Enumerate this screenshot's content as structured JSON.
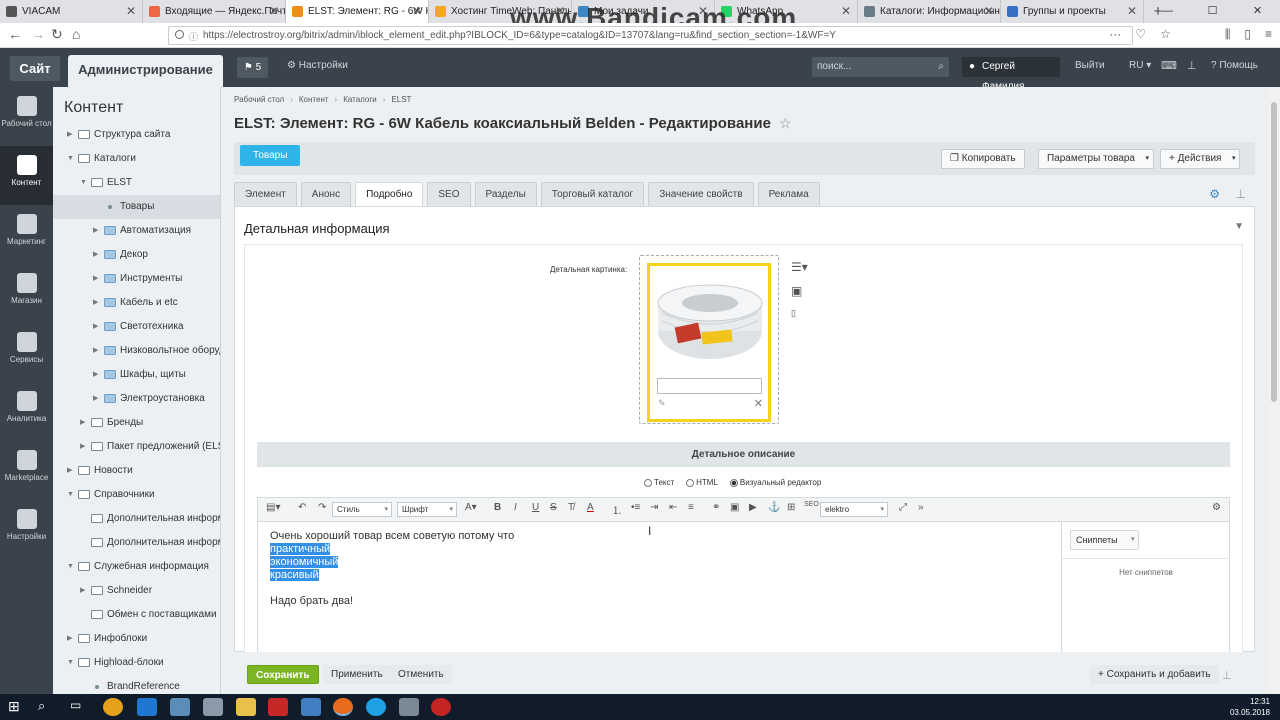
{
  "browser": {
    "tabs": [
      {
        "title": "VIACAM",
        "color": "#555"
      },
      {
        "title": "Входящие — Яндекс.Почта",
        "color": "#e64"
      },
      {
        "title": "ELST: Элемент: RG - 6W Кабе",
        "color": "#f28c1e",
        "active": true
      },
      {
        "title": "Хостинг TimeWeb: Панель",
        "color": "#f5a623"
      },
      {
        "title": "Мои задачи",
        "color": "#3b86c4"
      },
      {
        "title": "WhatsApp",
        "color": "#25d366"
      },
      {
        "title": "Каталоги: Информационн",
        "color": "#6a7b88"
      },
      {
        "title": "Группы и проекты",
        "color": "#3b6fc4"
      }
    ],
    "new_tab": "+",
    "watermark": "www.Bandicam.com",
    "url": "https://electrostroy.org/bitrix/admin/iblock_element_edit.php?IBLOCK_ID=6&type=catalog&ID=13707&lang=ru&find_section_section=-1&WF=Y"
  },
  "topbar": {
    "site": "Сайт",
    "admin": "Администрирование",
    "notifications": "5",
    "settings": "Настройки",
    "search_placeholder": "поиск...",
    "user": "Сергей Фамилия",
    "logout": "Выйти",
    "lang": "RU",
    "help": "Помощь"
  },
  "rail": [
    {
      "label": "Рабочий стол",
      "icon": "home-icon"
    },
    {
      "label": "Контент",
      "icon": "document-icon",
      "active": true
    },
    {
      "label": "Маркетинг",
      "icon": "target-icon"
    },
    {
      "label": "Магазин",
      "icon": "basket-icon"
    },
    {
      "label": "Сервисы",
      "icon": "layers-icon"
    },
    {
      "label": "Аналитика",
      "icon": "bar-chart-icon"
    },
    {
      "label": "Marketplace",
      "icon": "cloud-icon"
    },
    {
      "label": "Настройки",
      "icon": "gear-icon"
    }
  ],
  "tree": {
    "title": "Контент",
    "items": [
      {
        "label": "Структура сайта",
        "level": 0,
        "icon": "page",
        "arrow": "▶"
      },
      {
        "label": "Каталоги",
        "level": 0,
        "icon": "page",
        "arrow": "▼"
      },
      {
        "label": "ELST",
        "level": 1,
        "icon": "page",
        "arrow": "▼"
      },
      {
        "label": "Товары",
        "level": 2,
        "icon": "dot",
        "arrow": "",
        "selected": true
      },
      {
        "label": "Автоматизация",
        "level": 2,
        "icon": "folder",
        "arrow": "▶"
      },
      {
        "label": "Декор",
        "level": 2,
        "icon": "folder",
        "arrow": "▶"
      },
      {
        "label": "Инструменты",
        "level": 2,
        "icon": "folder",
        "arrow": "▶"
      },
      {
        "label": "Кабель и etc",
        "level": 2,
        "icon": "folder",
        "arrow": "▶"
      },
      {
        "label": "Светотехника",
        "level": 2,
        "icon": "folder",
        "arrow": "▶"
      },
      {
        "label": "Низковольтное оборудов",
        "level": 2,
        "icon": "folder",
        "arrow": "▶"
      },
      {
        "label": "Шкафы, щиты",
        "level": 2,
        "icon": "folder",
        "arrow": "▶"
      },
      {
        "label": "Электроустановка",
        "level": 2,
        "icon": "folder",
        "arrow": "▶"
      },
      {
        "label": "Бренды",
        "level": 1,
        "icon": "page",
        "arrow": "▶"
      },
      {
        "label": "Пакет предложений (ELST)",
        "level": 1,
        "icon": "page",
        "arrow": "▶"
      },
      {
        "label": "Новости",
        "level": 0,
        "icon": "page",
        "arrow": "▶"
      },
      {
        "label": "Справочники",
        "level": 0,
        "icon": "page",
        "arrow": "▼"
      },
      {
        "label": "Дополнительная информаци",
        "level": 1,
        "icon": "page",
        "arrow": ""
      },
      {
        "label": "Дополнительная информаци",
        "level": 1,
        "icon": "page",
        "arrow": ""
      },
      {
        "label": "Служебная информация",
        "level": 0,
        "icon": "page",
        "arrow": "▼"
      },
      {
        "label": "Schneider",
        "level": 1,
        "icon": "page",
        "arrow": "▶"
      },
      {
        "label": "Обмен с поставщиками",
        "level": 1,
        "icon": "page",
        "arrow": ""
      },
      {
        "label": "Инфоблоки",
        "level": 0,
        "icon": "page",
        "arrow": "▶"
      },
      {
        "label": "Highload-блоки",
        "level": 0,
        "icon": "page",
        "arrow": "▼"
      },
      {
        "label": "BrandReference",
        "level": 1,
        "icon": "dot",
        "arrow": ""
      }
    ]
  },
  "breadcrumbs": [
    "Рабочий стол",
    "Контент",
    "Каталоги",
    "ELST"
  ],
  "page_title": "ELST: Элемент: RG - 6W Кабель коаксиальный Belden - Редактирование",
  "actions": {
    "goods": "Товары",
    "copy": "Копировать",
    "params": "Параметры товара",
    "actions": "Действия"
  },
  "tabs": [
    "Элемент",
    "Анонс",
    "Подробно",
    "SEO",
    "Разделы",
    "Торговый каталог",
    "Значение свойств",
    "Реклама"
  ],
  "active_tab": "Подробно",
  "section": {
    "title": "Детальная информация",
    "picture_label": "Детальная картинка:",
    "description_title": "Детальное описание",
    "modes": [
      "Текст",
      "HTML",
      "Визуальный редактор"
    ],
    "active_mode": "Визуальный редактор"
  },
  "toolbar": {
    "style": "Стиль",
    "font": "Шрифт",
    "template": "elektro"
  },
  "editor": {
    "line1": "Очень хороший товар всем советую потому что",
    "sel1": "практичный",
    "sel2": "экономичный",
    "sel3": "красивый",
    "line5": "Надо брать два!"
  },
  "snippets": {
    "button": "Сниппеты",
    "empty": "Нет сниппетов"
  },
  "bottom": {
    "save": "Сохранить",
    "apply": "Применить",
    "cancel": "Отменить",
    "save_add": "Сохранить и добавить"
  },
  "clock": {
    "time": "12:31",
    "date": "03.05.2018"
  }
}
